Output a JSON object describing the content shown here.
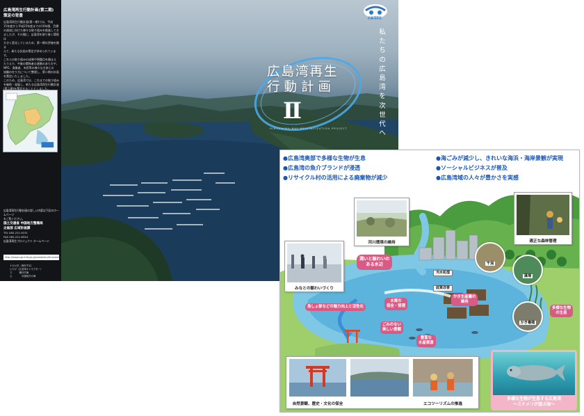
{
  "cover": {
    "side_title_1": "広島湾再生行動計画(第二期)",
    "side_title_2": "策定の背景",
    "side_body": [
      "広島湾再生行動計画(第一期)では、平成",
      "15年度から平成25年度までの10年間、目標",
      "の達成に向けた様々な取り組みを推進してき",
      "ましたが、その間に、広島湾を取り巻く環境は",
      "大きく変化しているため、第一期の評価を踏ま",
      "えて、新たな計画の策定が求められています。",
      "これらの取り組みの成果や問題点を踏まえ",
      "たうえで、今後の関係者の連携のあり方や、",
      "NPO、漁業者、市民等の様々な主体との",
      "協働の在り方について整理し、第二期の計画",
      "を策定いたしました。",
      "このため、広島湾では、これまでの取り組み",
      "を継続・発展し、新たな広島湾再生行動計画",
      "(第二期)を策定することとしました。"
    ],
    "side_footer": {
      "line1": "広島湾再生行動計画の詳しい内容は下記のホームページ",
      "line2": "をご覧ください。",
      "org1": "国土交通省 中国地方整備局",
      "org2": "企画部 広域計画課",
      "tel1": "TEL 082-221-9231",
      "tel2": "FAX 082-221-6344",
      "project": "広島湾再生プロジェクト ホームページ"
    },
    "url": "http://www.cgr.mlit.go.jp/ootakaku/hiroshima",
    "small_text": [
      "ナガメ鳥（海を守る）",
      "ヒロマ（広島湾キャラクター）",
      "ス　　　瀬戸内海",
      "公　　　　中国地方の海"
    ],
    "title_line1": "広島湾再生",
    "title_line2": "行動計画",
    "roman": "Ⅱ",
    "subtitle_en": "HIROSHIMA BAY REVITALIZATION PROJECT",
    "vertical_text": "私たちの広島湾を次世代へ",
    "logo_text": "広島湾再生"
  },
  "front": {
    "goals_left": [
      "●広島湾奥部で多様な生物が生息",
      "●広島湾の魚介ブランドが浸透",
      "●リサイクル村の活用による廃棄物が減少"
    ],
    "goals_right": [
      "●海ごみが減少し、きれいな海浜・海岸景観が実現",
      "●ソーシャルビジネスが普及",
      "●広島湾域の人々が豊かさを実感"
    ],
    "captions": {
      "river": "河川環境の維持",
      "forest": "適正な森林管理",
      "minato": "みなとの賑わいづくり",
      "nature": "自然景観、歴史・文化の保全",
      "eco": "エコツーリズムの推進"
    },
    "pills": {
      "waterfront": "潤いと賑わいの\nある水辺",
      "island": "島しょ部などの魅力向上と活性化",
      "quality": "水質の\n保全・管理",
      "oyster": "かき生産量の\n維持",
      "species": "多様な生物\nの生息",
      "clean": "ごみのない\n美しい景観",
      "fish": "豊富な\n水産資源"
    },
    "labels": {
      "sewage": "汚水処理",
      "soil": "底質改善"
    },
    "circles": {
      "tideflat": "干潟",
      "seaweed": "藻場",
      "oyster_farm": "かき養殖"
    },
    "highlight": "多様な生物が生息する広島湾\n〜スナメリが遊ぶ海〜"
  }
}
